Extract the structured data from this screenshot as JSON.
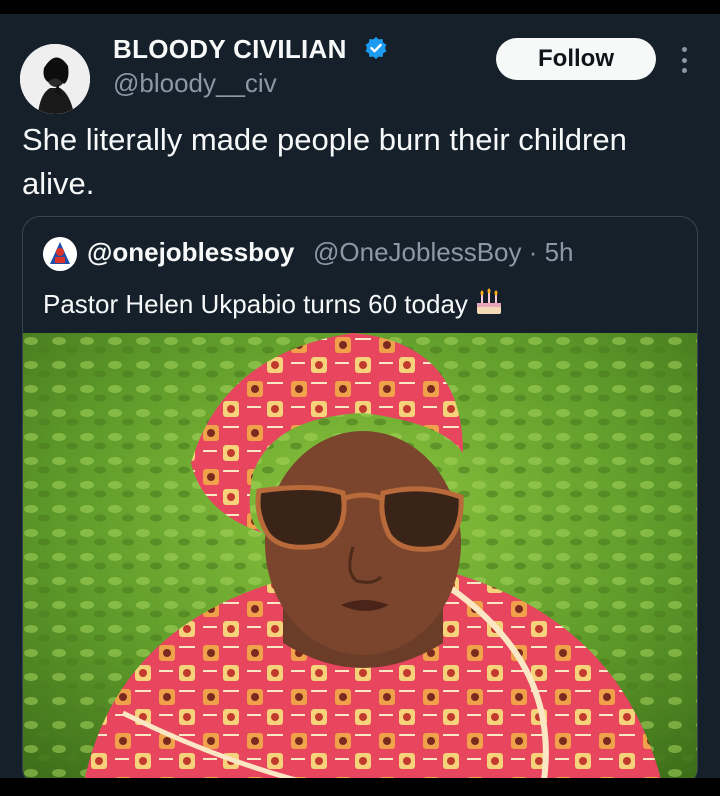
{
  "tweet": {
    "author_name": "BLOODY CIVILIAN",
    "author_handle": "@bloody__civ",
    "follow_label": "Follow",
    "text": "She literally made people burn their children alive."
  },
  "quoted_tweet": {
    "author_name": "@onejoblessboy",
    "author_handle_time": "@OneJoblessBoy · 5h",
    "text": "Pastor Helen Ukpabio turns 60 today"
  },
  "icons": {
    "verified": "verified-badge-icon",
    "more": "more-vertical-icon",
    "cake": "birthday-cake-icon"
  },
  "colors": {
    "background": "#15202b",
    "text_primary": "#f7f9f9",
    "text_secondary": "#8b98a5",
    "verified_blue": "#1d9bf0",
    "border": "#38444d",
    "follow_button_bg": "#f7f9f9"
  }
}
